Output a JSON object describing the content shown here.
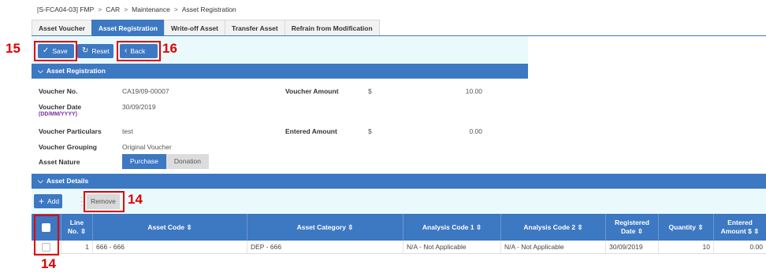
{
  "breadcrumb": {
    "items": [
      "[S-FCA04-03] FMP",
      "CAR",
      "Maintenance",
      "Asset Registration"
    ],
    "separator": ">"
  },
  "tabs": [
    {
      "label": "Asset Voucher",
      "active": false
    },
    {
      "label": "Asset Registration",
      "active": true
    },
    {
      "label": "Write-off Asset",
      "active": false
    },
    {
      "label": "Transfer Asset",
      "active": false
    },
    {
      "label": "Refrain from Modification",
      "active": false
    }
  ],
  "toolbar": {
    "save_label": "Save",
    "reset_label": "Reset",
    "back_label": "Back"
  },
  "asset_registration": {
    "header": "Asset Registration",
    "voucher_no_label": "Voucher No.",
    "voucher_no": "CA19/09-00007",
    "voucher_date_label": "Voucher Date",
    "voucher_date_format": "(DD/MM/YYYY)",
    "voucher_date": "30/09/2019",
    "voucher_particulars_label": "Voucher Particulars",
    "voucher_particulars": "test",
    "voucher_grouping_label": "Voucher Grouping",
    "voucher_grouping": "Original Voucher",
    "asset_nature_label": "Asset Nature",
    "asset_nature_options": [
      "Purchase",
      "Donation"
    ],
    "asset_nature_selected": "Purchase",
    "voucher_amount_label": "Voucher Amount",
    "voucher_amount_currency": "$",
    "voucher_amount": "10.00",
    "entered_amount_label": "Entered Amount",
    "entered_amount_currency": "$",
    "entered_amount": "0.00"
  },
  "asset_details": {
    "header": "Asset Details",
    "add_label": "Add",
    "remove_label": "Remove",
    "columns": [
      {
        "l1": "",
        "l2": ""
      },
      {
        "l1": "Line",
        "l2": "No. ⇳"
      },
      {
        "l1": "Asset Code ⇳",
        "l2": ""
      },
      {
        "l1": "Asset Category ⇳",
        "l2": ""
      },
      {
        "l1": "Analysis Code 1 ⇳",
        "l2": ""
      },
      {
        "l1": "Analysis Code 2 ⇳",
        "l2": ""
      },
      {
        "l1": "Registered",
        "l2": "Date ⇳"
      },
      {
        "l1": "Quantity ⇳",
        "l2": ""
      },
      {
        "l1": "Entered",
        "l2": "Amount $ ⇳"
      }
    ],
    "rows": [
      {
        "line_no": "1",
        "asset_code": "666 - 666",
        "asset_category": "DEP - 666",
        "analysis_code_1": "N/A - Not Applicable",
        "analysis_code_2": "N/A - Not Applicable",
        "registered_date": "30/09/2019",
        "quantity": "10",
        "entered_amount": "0.00"
      }
    ]
  },
  "annotations": {
    "n15": "15",
    "n16": "16",
    "n14_remove": "14",
    "n14_checkbox": "14",
    "color": "#e00000"
  }
}
